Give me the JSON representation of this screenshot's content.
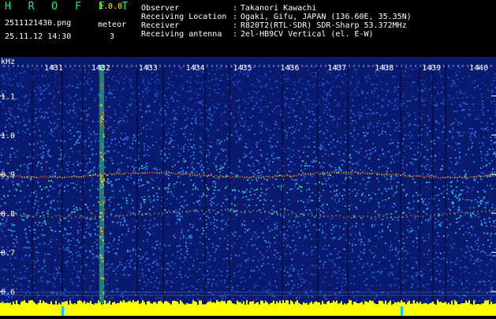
{
  "header": {
    "app_title": "H R O F F T",
    "app_version": "1.0.0",
    "file_name": "2511121430.png",
    "timestamp": "25.11.12 14:30",
    "meteor_label": "meteor",
    "meteor_count": "3"
  },
  "info": [
    {
      "key": "Observer",
      "sep": ":",
      "value": "Takanori Kawachi"
    },
    {
      "key": "Receiving Location",
      "sep": ":",
      "value": "Ogaki, Gifu, JAPAN (136.60E, 35.35N)"
    },
    {
      "key": "Receiver",
      "sep": ":",
      "value": "R820T2(RTL-SDR) SDR-Sharp 53.372MHz"
    },
    {
      "key": "Receiving antenna",
      "sep": ":",
      "value": "2el-HB9CV Vertical (el. E-W)"
    }
  ],
  "spectrogram": {
    "unit_label": "kHz",
    "time_labels": [
      "1431",
      "1432",
      "1433",
      "1434",
      "1435",
      "1436",
      "1437",
      "1438",
      "1439",
      "1440"
    ],
    "freq_labels": [
      "1.1",
      "1.0",
      "0.9",
      "0.8",
      "0.7",
      "0.6"
    ],
    "freq_values": [
      1.1,
      1.0,
      0.9,
      0.8,
      0.7,
      0.6
    ],
    "freq_range_khz": [
      0.57,
      1.2
    ],
    "background_color": "#0a1a6e",
    "label_color": "#ffffff",
    "meteor_color": "#ffff00"
  }
}
